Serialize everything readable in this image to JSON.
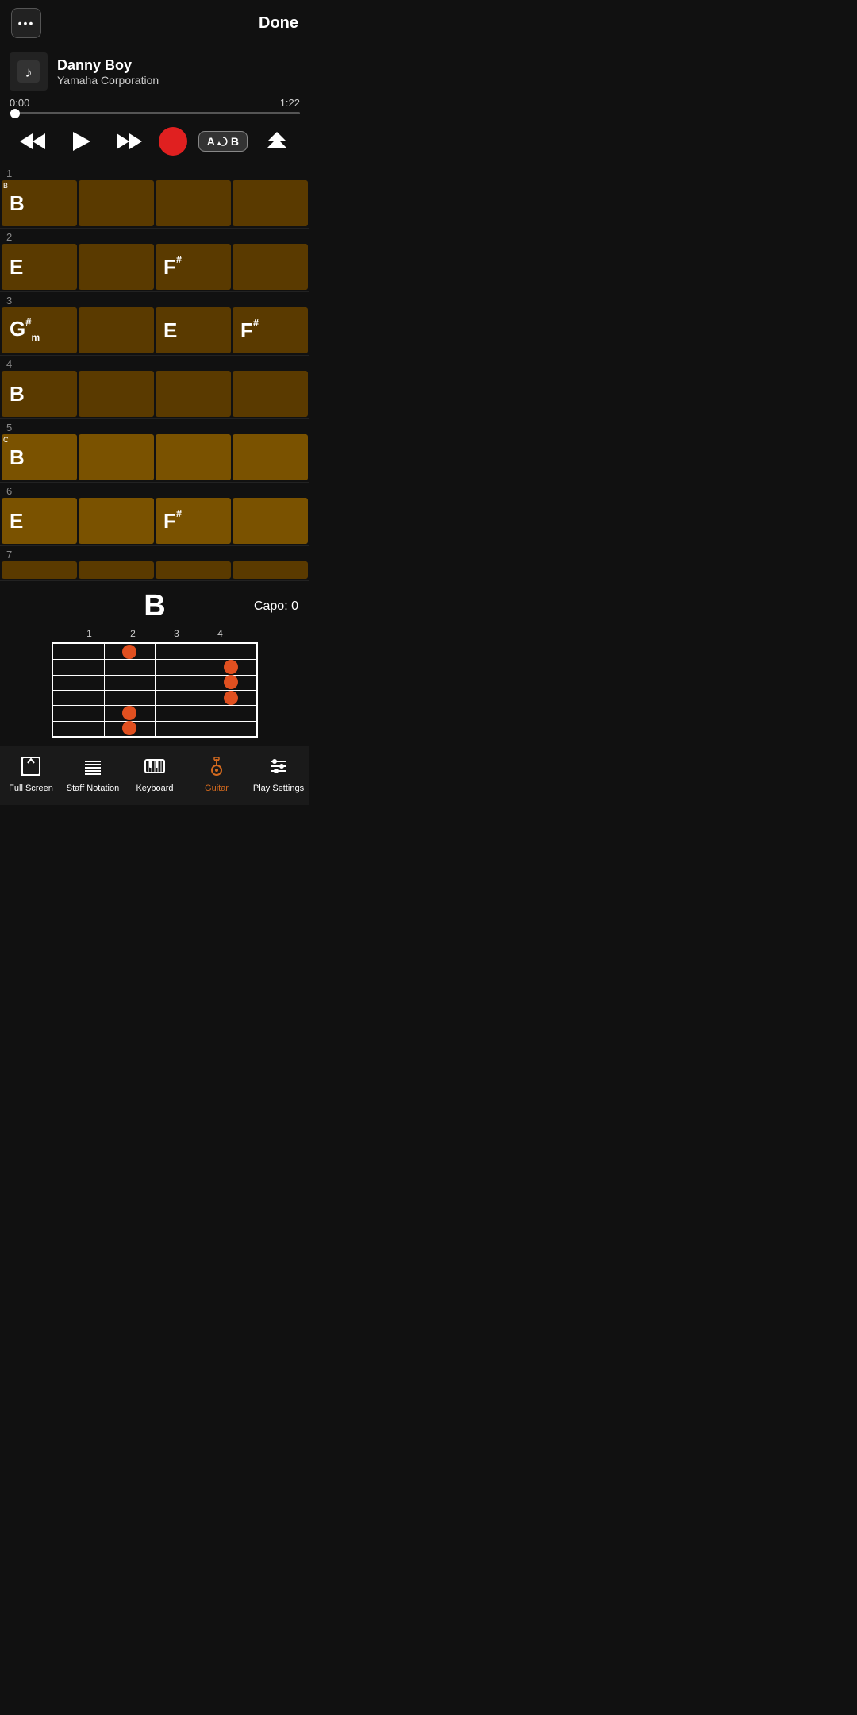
{
  "header": {
    "menu_label": "•••",
    "done_label": "Done"
  },
  "song": {
    "title": "Danny Boy",
    "artist": "Yamaha Corporation"
  },
  "playback": {
    "current_time": "0:00",
    "total_time": "1:22",
    "progress_pct": 2
  },
  "controls": {
    "rewind_label": "⏮",
    "play_label": "▶",
    "forward_label": "⏭",
    "ab_label": "A↻B",
    "priority_label": "⋀⋀"
  },
  "chord_rows": [
    {
      "row_num": "1",
      "tag": "B",
      "cells": [
        {
          "chord": "B",
          "sup": "",
          "sub": "",
          "filled": true,
          "lighter": false
        },
        {
          "chord": "",
          "sup": "",
          "sub": "",
          "filled": true,
          "lighter": false
        },
        {
          "chord": "",
          "sup": "",
          "sub": "",
          "filled": true,
          "lighter": false
        },
        {
          "chord": "",
          "sup": "",
          "sub": "",
          "filled": true,
          "lighter": false
        }
      ]
    },
    {
      "row_num": "2",
      "tag": "",
      "cells": [
        {
          "chord": "E",
          "sup": "",
          "sub": "",
          "filled": true,
          "lighter": false
        },
        {
          "chord": "",
          "sup": "",
          "sub": "",
          "filled": true,
          "lighter": false
        },
        {
          "chord": "F",
          "sup": "#",
          "sub": "",
          "filled": true,
          "lighter": false
        },
        {
          "chord": "",
          "sup": "",
          "sub": "",
          "filled": true,
          "lighter": false
        }
      ]
    },
    {
      "row_num": "3",
      "tag": "",
      "cells": [
        {
          "chord": "G",
          "sup": "#",
          "sub": "m",
          "filled": true,
          "lighter": false
        },
        {
          "chord": "",
          "sup": "",
          "sub": "",
          "filled": true,
          "lighter": false
        },
        {
          "chord": "E",
          "sup": "",
          "sub": "",
          "filled": true,
          "lighter": false
        },
        {
          "chord": "F",
          "sup": "#",
          "sub": "",
          "filled": true,
          "lighter": false
        }
      ]
    },
    {
      "row_num": "4",
      "tag": "",
      "cells": [
        {
          "chord": "B",
          "sup": "",
          "sub": "",
          "filled": true,
          "lighter": false
        },
        {
          "chord": "",
          "sup": "",
          "sub": "",
          "filled": true,
          "lighter": false
        },
        {
          "chord": "",
          "sup": "",
          "sub": "",
          "filled": true,
          "lighter": false
        },
        {
          "chord": "",
          "sup": "",
          "sub": "",
          "filled": true,
          "lighter": false
        }
      ]
    },
    {
      "row_num": "5",
      "tag": "C",
      "cells": [
        {
          "chord": "B",
          "sup": "",
          "sub": "",
          "filled": true,
          "lighter": true
        },
        {
          "chord": "",
          "sup": "",
          "sub": "",
          "filled": true,
          "lighter": true
        },
        {
          "chord": "",
          "sup": "",
          "sub": "",
          "filled": true,
          "lighter": true
        },
        {
          "chord": "",
          "sup": "",
          "sub": "",
          "filled": true,
          "lighter": true
        }
      ]
    },
    {
      "row_num": "6",
      "tag": "",
      "cells": [
        {
          "chord": "E",
          "sup": "",
          "sub": "",
          "filled": true,
          "lighter": true
        },
        {
          "chord": "",
          "sup": "",
          "sub": "",
          "filled": true,
          "lighter": true
        },
        {
          "chord": "F",
          "sup": "#",
          "sub": "",
          "filled": true,
          "lighter": true
        },
        {
          "chord": "",
          "sup": "",
          "sub": "",
          "filled": true,
          "lighter": true
        }
      ]
    },
    {
      "row_num": "7",
      "tag": "",
      "cells": [
        {
          "chord": "",
          "sup": "",
          "sub": "",
          "filled": true,
          "lighter": true
        },
        {
          "chord": "",
          "sup": "",
          "sub": "",
          "filled": true,
          "lighter": true
        },
        {
          "chord": "",
          "sup": "",
          "sub": "",
          "filled": true,
          "lighter": true
        },
        {
          "chord": "",
          "sup": "",
          "sub": "",
          "filled": true,
          "lighter": true
        }
      ]
    }
  ],
  "chord_diagram": {
    "chord_name": "B",
    "capo": "Capo: 0",
    "fret_numbers": [
      "1",
      "2",
      "3",
      "4"
    ],
    "dots": [
      {
        "string": 1,
        "fret": 2,
        "note": "finger"
      },
      {
        "string": 2,
        "fret": 4,
        "note": "finger"
      },
      {
        "string": 3,
        "fret": 4,
        "note": "finger"
      },
      {
        "string": 4,
        "fret": 4,
        "note": "finger"
      },
      {
        "string": 5,
        "fret": 2,
        "note": "finger"
      },
      {
        "string": 6,
        "fret": 2,
        "note": "finger"
      }
    ]
  },
  "bottom_nav": {
    "items": [
      {
        "id": "fullscreen",
        "label": "Full Screen",
        "active": false
      },
      {
        "id": "staff",
        "label": "Staff\nNotation",
        "active": false
      },
      {
        "id": "keyboard",
        "label": "Keyboard",
        "active": false
      },
      {
        "id": "guitar",
        "label": "Guitar",
        "active": true
      },
      {
        "id": "playsettings",
        "label": "Play Settings",
        "active": false
      }
    ]
  }
}
